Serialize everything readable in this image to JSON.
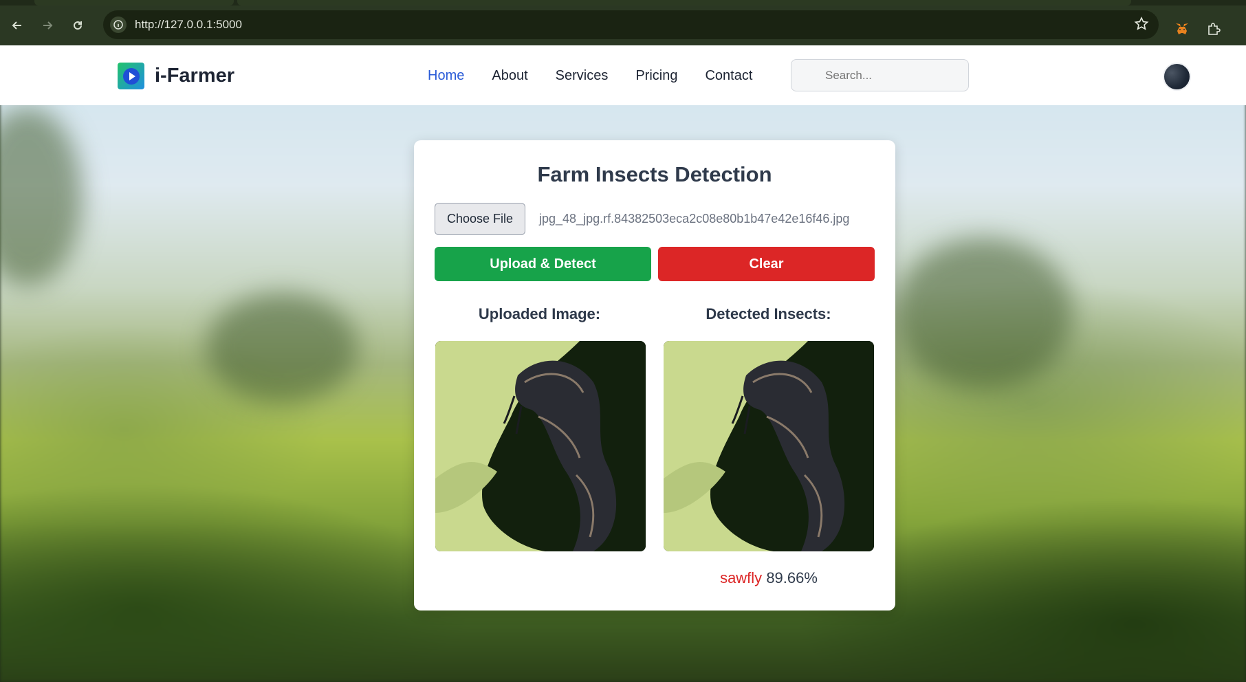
{
  "browser": {
    "url": "http://127.0.0.1:5000"
  },
  "site": {
    "brand": "i-Farmer",
    "nav": [
      {
        "label": "Home",
        "active": true
      },
      {
        "label": "About"
      },
      {
        "label": "Services"
      },
      {
        "label": "Pricing"
      },
      {
        "label": "Contact"
      }
    ],
    "search_placeholder": "Search..."
  },
  "card": {
    "title": "Farm Insects Detection",
    "choose_file_label": "Choose File",
    "file_name": "jpg_48_jpg.rf.84382503eca2c08e80b1b47e42e16f46.jpg",
    "upload_label": "Upload & Detect",
    "clear_label": "Clear",
    "uploaded_title": "Uploaded Image:",
    "detected_title": "Detected Insects:",
    "result_label": "sawfly",
    "result_confidence": "89.66%"
  },
  "colors": {
    "accent": "#2a5bd7",
    "upload": "#17a34a",
    "clear": "#dc2626"
  }
}
